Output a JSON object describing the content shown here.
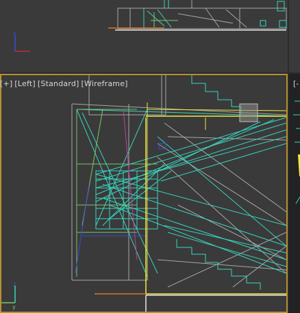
{
  "viewport_main": {
    "labels": [
      "[+]",
      "[Left]",
      "[Standard]",
      "[Wireframe]"
    ]
  },
  "viewport_right": {
    "label": "[-"
  },
  "axis": {
    "z": "z",
    "y": "y"
  },
  "colors": {
    "active_border": "#b8922f",
    "cyan": "#38d6c0",
    "yellow": "#f2ec3c",
    "orange": "#d9782a",
    "grey": "#9c9c9c",
    "white": "#e8e8e8",
    "green": "#7bc86a",
    "blue": "#3a4fd6",
    "magenta": "#c040a0"
  }
}
